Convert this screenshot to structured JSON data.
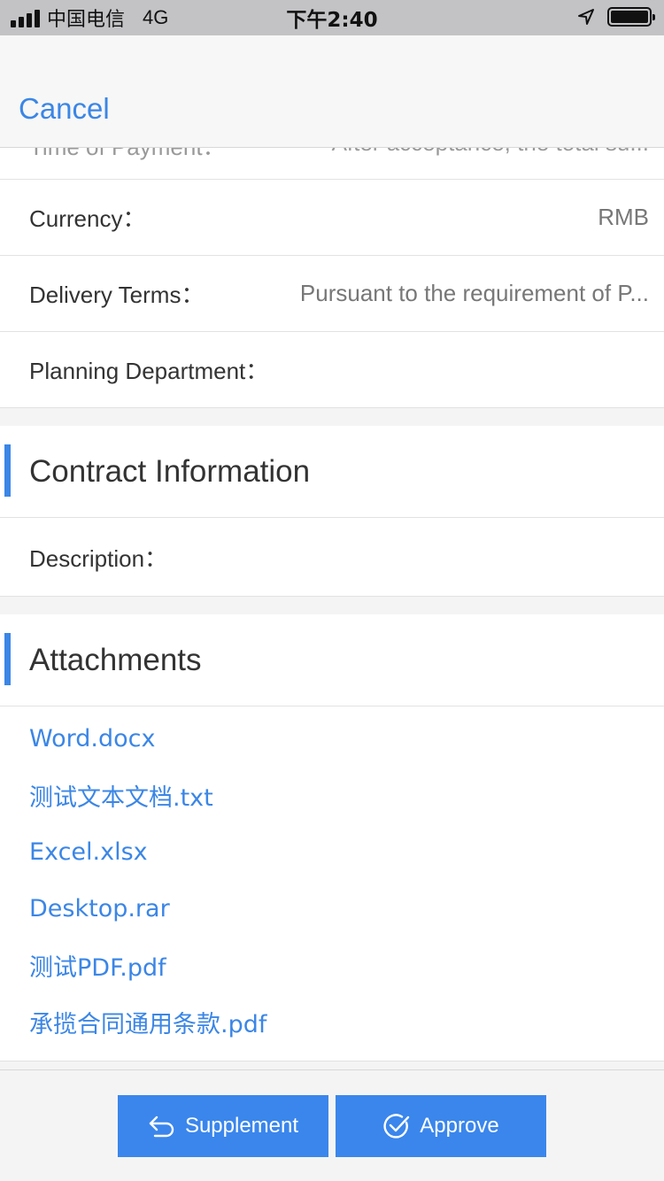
{
  "status_bar": {
    "carrier": "中国电信",
    "network": "4G",
    "time": "下午2:40"
  },
  "nav": {
    "cancel_label": "Cancel"
  },
  "partial_row": {
    "label": "Time of Payment：",
    "value": "After acceptance, the total su..."
  },
  "fields": [
    {
      "label": "Currency：",
      "value": "RMB"
    },
    {
      "label": "Delivery Terms：",
      "value": "Pursuant to the requirement of P..."
    },
    {
      "label": "Planning Department：",
      "value": ""
    }
  ],
  "contract_section": {
    "title": "Contract Information",
    "description_label": "Description："
  },
  "attachments_section": {
    "title": "Attachments",
    "files": [
      "Word.docx",
      "测试文本文档.txt",
      "Excel.xlsx",
      "Desktop.rar",
      "测试PDF.pdf",
      "承揽合同通用条款.pdf"
    ]
  },
  "actions": {
    "supplement_label": "Supplement",
    "approve_label": "Approve"
  },
  "colors": {
    "accent": "#3b86e6",
    "button": "#3a86ec"
  },
  "icons": {
    "supplement": "return-arrow-icon",
    "approve": "check-circle-icon"
  }
}
